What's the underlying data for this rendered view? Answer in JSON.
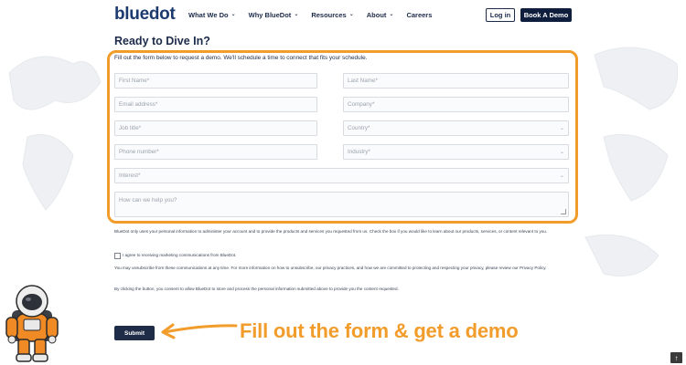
{
  "header": {
    "logo": "bluedot",
    "nav": [
      {
        "label": "What We Do",
        "has_dropdown": true
      },
      {
        "label": "Why BlueDot",
        "has_dropdown": true
      },
      {
        "label": "Resources",
        "has_dropdown": true
      },
      {
        "label": "About",
        "has_dropdown": true
      },
      {
        "label": "Careers",
        "has_dropdown": false
      }
    ],
    "login_label": "Log in",
    "demo_label": "Book A Demo"
  },
  "form": {
    "title": "Ready to Dive In?",
    "intro": "Fill out the form below to request a demo. We'll schedule a time to connect that fits your schedule.",
    "first_name": "First Name*",
    "last_name": "Last Name*",
    "email": "Email address*",
    "company": "Company*",
    "job_title": "Job title*",
    "country": "Country*",
    "phone": "Phone number*",
    "industry": "Industry*",
    "interest": "Interest*",
    "message": "How can we help you?",
    "privacy_1": "BlueDot only uses your personal information to administer your account and to provide the products and services you requested from us. Check the box if you would like to learn about our products, services, or content relevant to you.",
    "consent_label": "I agree to receiving marketing communications from BlueDot.",
    "privacy_2": "You may unsubscribe from these communications at any time. For more information on how to unsubscribe, our privacy practices, and how we are committed to protecting and respecting your privacy, please review our Privacy Policy.",
    "privacy_3": "By clicking the button, you consent to allow BlueDot to store and process the personal information submitted above to provide you the content requested.",
    "submit_label": "Submit"
  },
  "callout": "Fill out the form & get a demo",
  "colors": {
    "accent_orange": "#f29c2b",
    "navy": "#0f1e3d",
    "logo_blue": "#1d3a6e"
  },
  "icons": [
    "chevron-down-icon",
    "arrow-left-icon",
    "astronaut-icon",
    "arrow-up-icon"
  ]
}
